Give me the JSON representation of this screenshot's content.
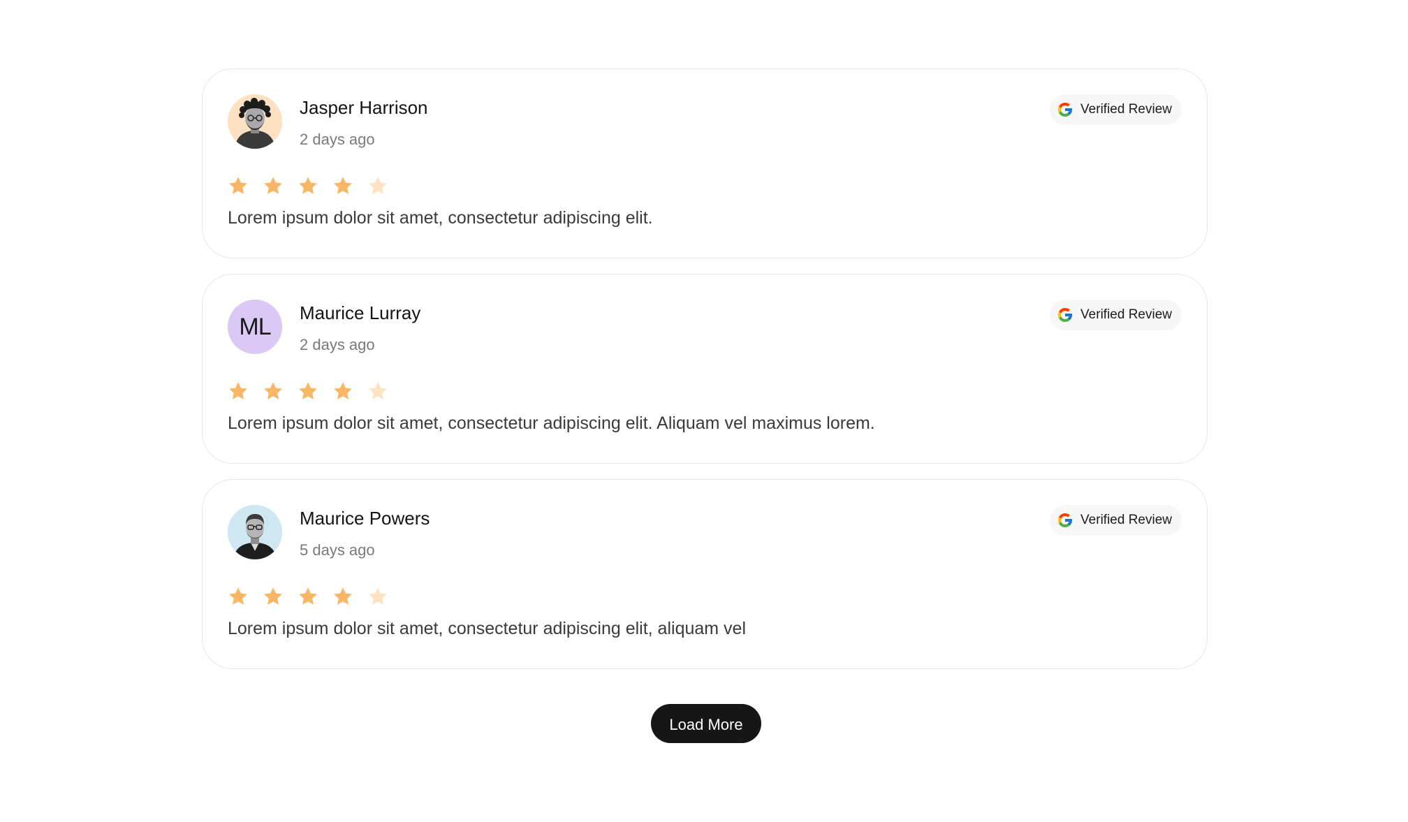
{
  "reviews": [
    {
      "name": "Jasper Harrison",
      "time": "2 days ago",
      "avatar": {
        "type": "photo",
        "bg": "#fde1c2"
      },
      "badge": "Verified Review",
      "rating": 4,
      "max_rating": 5,
      "text": "Lorem ipsum dolor sit amet, consectetur adipiscing elit."
    },
    {
      "name": "Maurice Lurray",
      "time": "2 days ago",
      "avatar": {
        "type": "initials",
        "initials": "ML",
        "bg": "#d9c9f4"
      },
      "badge": "Verified Review",
      "rating": 4,
      "max_rating": 5,
      "text": "Lorem ipsum dolor sit amet, consectetur adipiscing elit. Aliquam vel maximus lorem."
    },
    {
      "name": "Maurice Powers",
      "time": "5 days ago",
      "avatar": {
        "type": "photo",
        "bg": "#cfe7f1"
      },
      "badge": "Verified Review",
      "rating": 4,
      "max_rating": 5,
      "text": "Lorem ipsum dolor sit amet, consectetur adipiscing elit, aliquam vel"
    }
  ],
  "load_more_label": "Load More",
  "colors": {
    "star_filled": "#f9b664",
    "star_empty": "#fde3c1",
    "button_bg": "#161616"
  },
  "icons": {
    "badge": "google-icon",
    "rating": "star-icon"
  }
}
